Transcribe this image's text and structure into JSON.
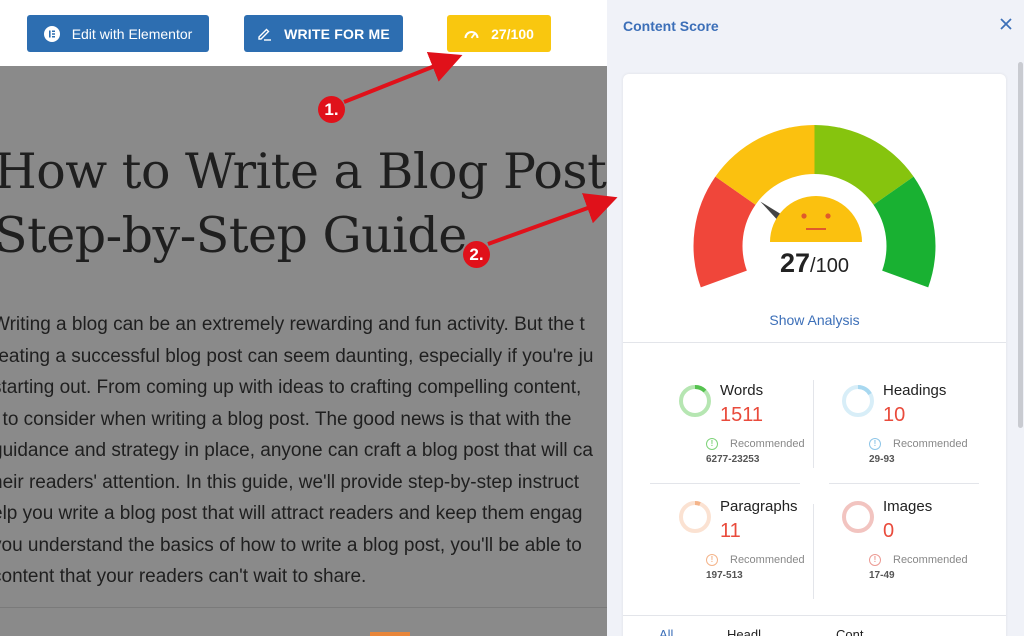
{
  "toolbar": {
    "elementor_label": "Edit with Elementor",
    "write_label": "WRITE FOR ME",
    "score_label": "27/100"
  },
  "editor": {
    "title_lines": [
      "How to Write a Blog Post: A",
      "Step-by-Step Guide"
    ],
    "body_lines": [
      "Writing a blog can be an extremely rewarding and fun activity. But the t",
      "reating a successful blog post can seem daunting, especially if you're ju",
      "starting out. From coming up with ideas to crafting compelling content,",
      "t to consider when writing a blog post. The good news is that with the",
      "guidance and strategy in place, anyone can craft a blog post that will ca",
      "heir readers' attention. In this guide, we'll provide step-by-step instruct",
      "elp you write a blog post that will attract readers and keep them engag",
      "you understand the basics of how to write a blog post, you'll be able to",
      "content that your readers can't wait to share."
    ]
  },
  "markers": [
    "1.",
    "2."
  ],
  "panel": {
    "title": "Content Score",
    "score": "27",
    "score_total": "/100",
    "score_value": 27,
    "show_analysis": "Show Analysis",
    "stats": [
      {
        "label": "Words",
        "value": "1511",
        "recommended": "Recommended",
        "range": "6277-23253",
        "ring_color": "#b6e6b2"
      },
      {
        "label": "Headings",
        "value": "10",
        "recommended": "Recommended",
        "range": "29-93",
        "ring_color": "#cfe9f6"
      },
      {
        "label": "Paragraphs",
        "value": "11",
        "recommended": "Recommended",
        "range": "197-513",
        "ring_color": "#f9d6c0"
      },
      {
        "label": "Images",
        "value": "0",
        "recommended": "Recommended",
        "range": "17-49",
        "ring_color": "#f2c4c0"
      }
    ],
    "bottom_tabs": [
      "All",
      "Headl",
      "Cont"
    ]
  },
  "colors": {
    "gauge_red": "#f0463a",
    "gauge_yellow": "#fbc10f",
    "gauge_lightgreen": "#86c40e",
    "gauge_green": "#19b132",
    "accent": "#3c6fb8"
  }
}
